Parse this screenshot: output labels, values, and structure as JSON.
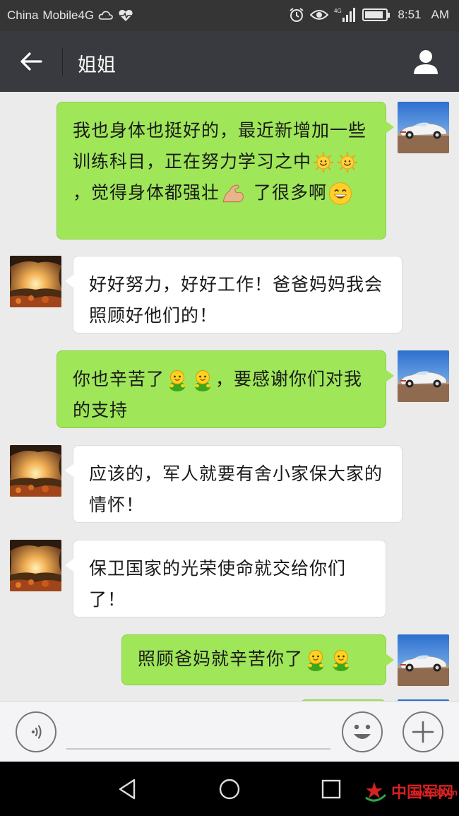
{
  "status_bar": {
    "carrier": "China",
    "network": "Mobile4G",
    "time": "8:51",
    "ampm": "AM",
    "battery_level": 0.9
  },
  "header": {
    "title": "姐姐",
    "back_icon": "back-arrow-icon",
    "profile_icon": "person-icon"
  },
  "messages": [
    {
      "sender": "me",
      "parts": [
        "我也身体也挺好的，最近新增加一些训练科目，正在努力学习之中",
        "，觉得身体都强壮",
        "了很多啊"
      ]
    },
    {
      "sender": "them",
      "text": "好好努力，好好工作！爸爸妈妈我会照顾好他们的！"
    },
    {
      "sender": "me",
      "parts": [
        "你也辛苦了",
        "，要感谢你们对我的支持"
      ]
    },
    {
      "sender": "them",
      "text": "应该的，军人就要有舍小家保大家的情怀！"
    },
    {
      "sender": "them",
      "text": "保卫国家的光荣使命就交给你们了！"
    },
    {
      "sender": "me",
      "parts": [
        "照顾爸妈就辛苦你了"
      ]
    }
  ],
  "input_bar": {
    "voice_icon": "voice-icon",
    "emoji_icon": "smiley-icon",
    "plus_icon": "plus-icon",
    "value": ""
  },
  "watermark": {
    "text": "中国军网",
    "url": "www.81.cn"
  },
  "colors": {
    "nav_bg": "#393a3f",
    "my_bubble": "#9fe658",
    "their_bubble": "#ffffff",
    "chat_bg": "#ebebeb"
  }
}
